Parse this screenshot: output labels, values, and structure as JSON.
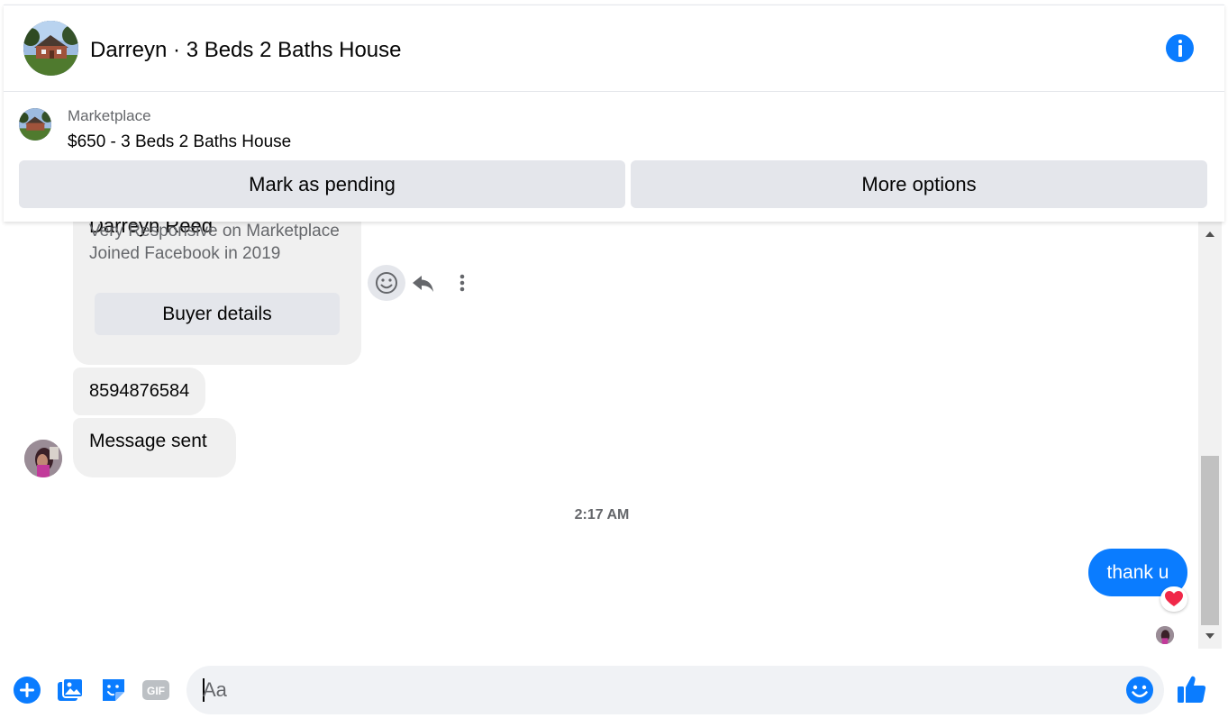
{
  "header": {
    "title": "Darreyn · 3 Beds 2 Baths House",
    "accent_color": "#0a7cff"
  },
  "listing": {
    "source": "Marketplace",
    "title": "$650 - 3 Beds 2 Baths House",
    "mark_pending_label": "Mark as pending",
    "more_options_label": "More options"
  },
  "buyer_card": {
    "name": "Darreyn Reed",
    "line1": "Very Responsive on Marketplace",
    "line2": "Joined Facebook in 2019",
    "button_label": "Buyer details"
  },
  "messages": {
    "phone": "8594876584",
    "sent": "Message sent",
    "timestamp": "2:17 AM",
    "my_reply": "thank u",
    "my_reply_reaction": "heart"
  },
  "composer": {
    "placeholder": "Aa",
    "gif_label": "GIF"
  }
}
